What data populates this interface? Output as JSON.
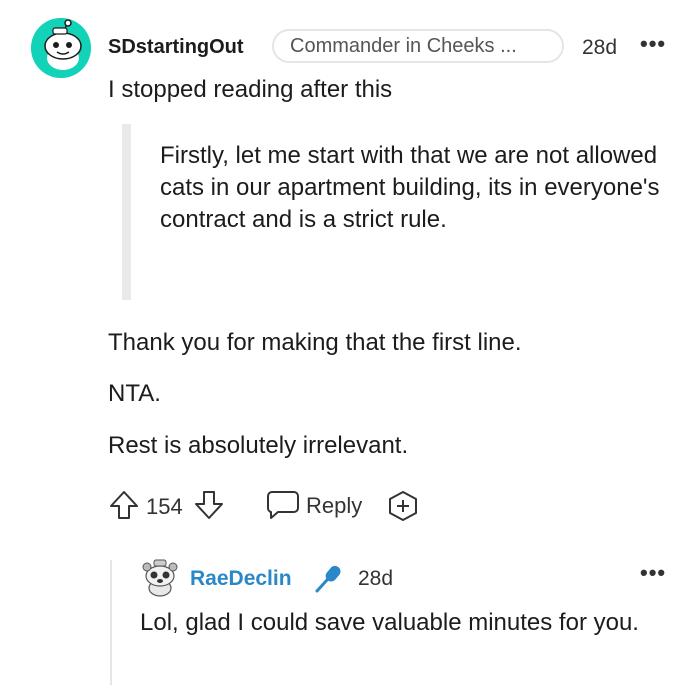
{
  "comment": {
    "username": "SDstartingOut",
    "flair": "Commander in Cheeks ...",
    "time": "28d",
    "more": "•••",
    "intro": "I stopped reading after this",
    "quote": "Firstly, let me start with that we are not allowed cats in our apartment building, its in everyone's contract and is a strict rule.",
    "paragraphs": [
      "Thank you for making that the first line.",
      "NTA.",
      "Rest is absolutely irrelevant."
    ],
    "vote_count": "154",
    "reply_label": "Reply",
    "icons": {
      "upvote": "upvote-arrow-icon",
      "downvote": "downvote-arrow-icon",
      "reply": "speech-bubble-icon",
      "award": "add-award-icon",
      "avatar": "snoo-avatar"
    }
  },
  "reply": {
    "username": "RaeDeclin",
    "time": "28d",
    "more": "•••",
    "text": "Lol, glad I could save valuable minutes for you.",
    "icons": {
      "badge": "microphone-icon",
      "avatar": "snoo-avatar-small"
    },
    "colors": {
      "username": "#2a88c8",
      "badge": "#2a88c8"
    }
  }
}
